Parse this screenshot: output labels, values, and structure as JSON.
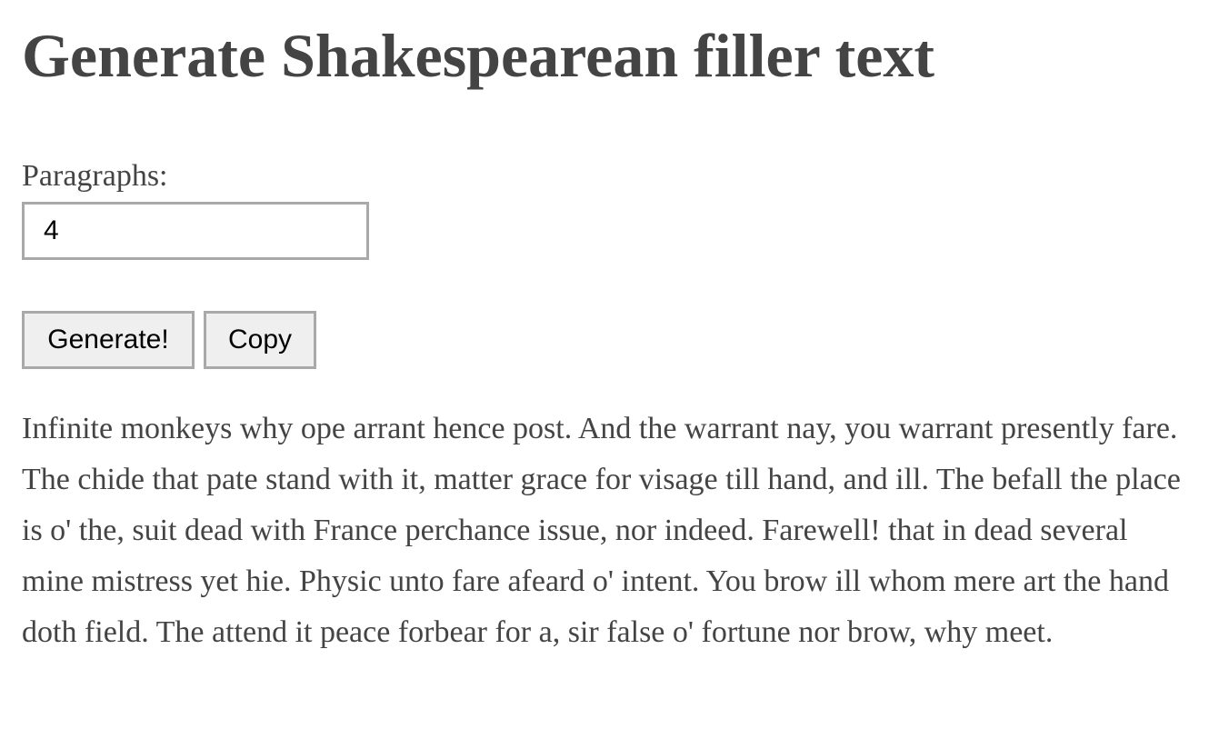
{
  "page": {
    "title": "Generate Shakespearean filler text"
  },
  "form": {
    "paragraphs_label": "Paragraphs:",
    "paragraphs_value": "4",
    "generate_label": "Generate!",
    "copy_label": "Copy"
  },
  "output": {
    "paragraphs": [
      "Infinite monkeys why ope arrant hence post. And the warrant nay, you warrant presently fare. The chide that pate stand with it, matter grace for visage till hand, and ill. The befall the place is o' the, suit dead with France perchance issue, nor indeed. Farewell! that in dead several mine mistress yet hie. Physic unto fare afeard o' intent. You brow ill whom mere art the hand doth field. The attend it peace forbear for a, sir false o' fortune nor brow, why meet."
    ]
  }
}
